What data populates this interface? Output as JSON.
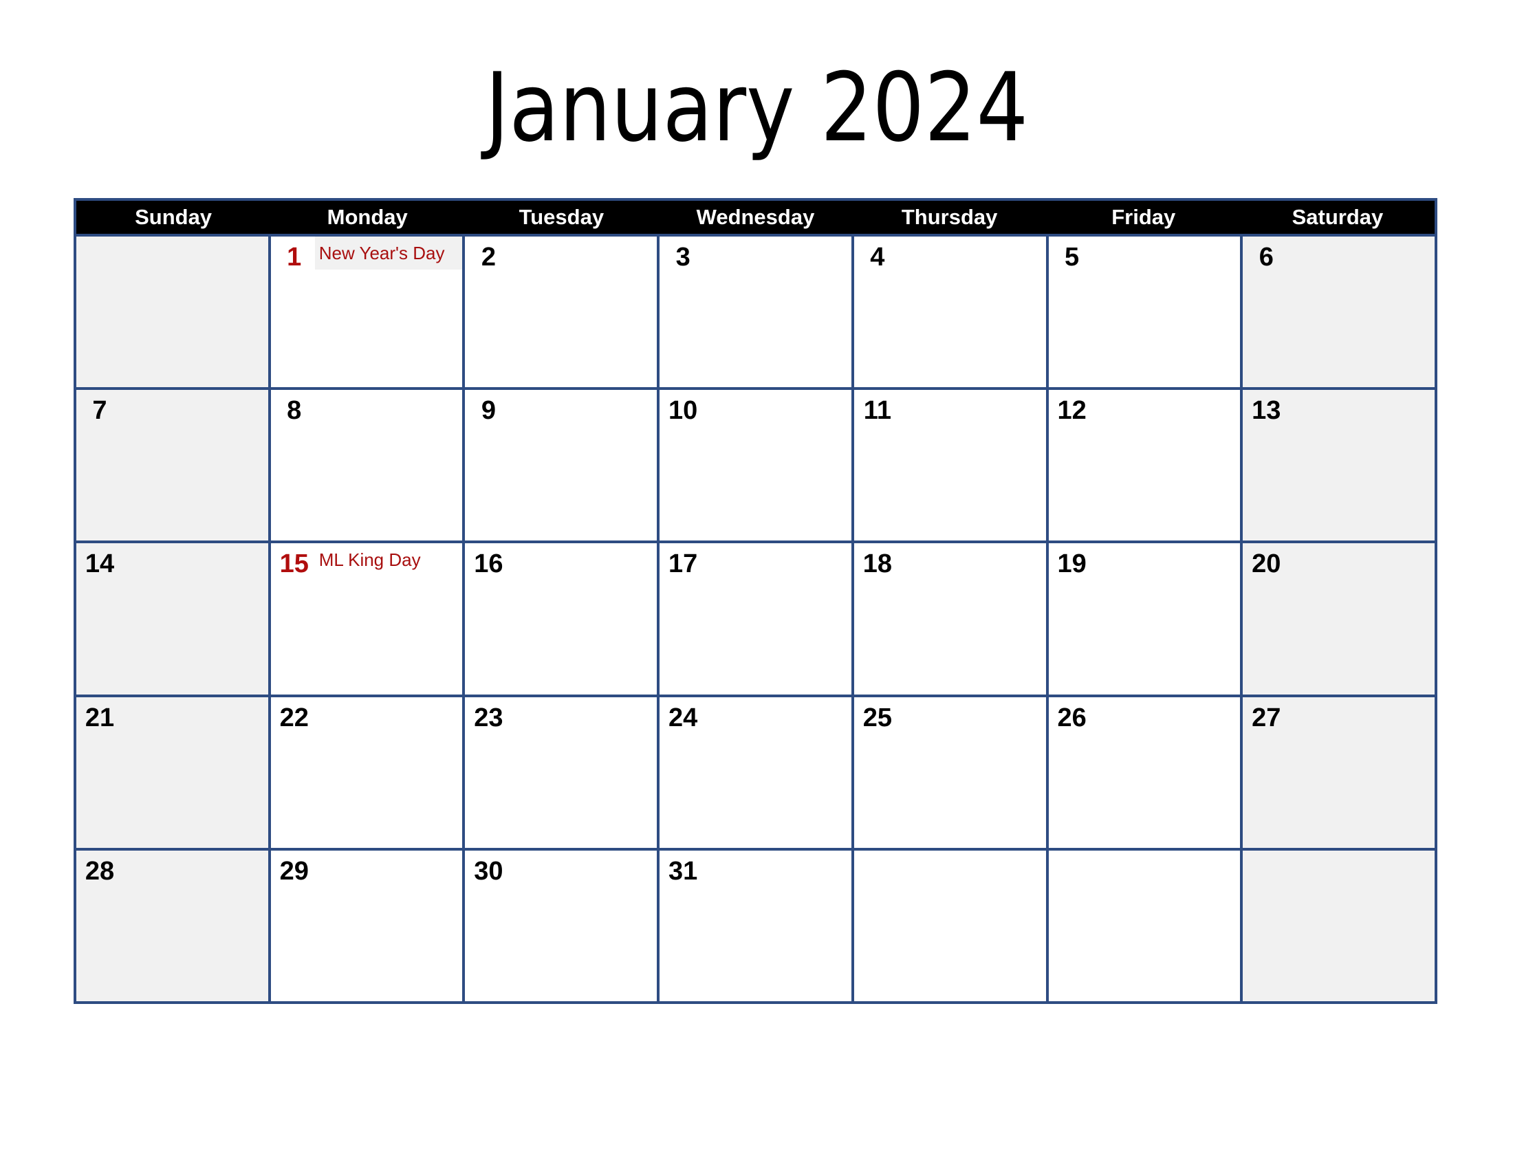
{
  "title": "January 2024",
  "weekdays": [
    "Sunday",
    "Monday",
    "Tuesday",
    "Wednesday",
    "Thursday",
    "Friday",
    "Saturday"
  ],
  "weeks": [
    [
      {
        "day": "",
        "weekend": true
      },
      {
        "day": "1",
        "holiday": "New Year's Day",
        "shaded_label": true
      },
      {
        "day": "2"
      },
      {
        "day": "3"
      },
      {
        "day": "4"
      },
      {
        "day": "5"
      },
      {
        "day": "6",
        "weekend": true
      }
    ],
    [
      {
        "day": "7",
        "weekend": true
      },
      {
        "day": "8"
      },
      {
        "day": "9"
      },
      {
        "day": "10"
      },
      {
        "day": "11"
      },
      {
        "day": "12"
      },
      {
        "day": "13",
        "weekend": true
      }
    ],
    [
      {
        "day": "14",
        "weekend": true
      },
      {
        "day": "15",
        "holiday": "ML King Day"
      },
      {
        "day": "16"
      },
      {
        "day": "17"
      },
      {
        "day": "18"
      },
      {
        "day": "19"
      },
      {
        "day": "20",
        "weekend": true
      }
    ],
    [
      {
        "day": "21",
        "weekend": true
      },
      {
        "day": "22"
      },
      {
        "day": "23"
      },
      {
        "day": "24"
      },
      {
        "day": "25"
      },
      {
        "day": "26"
      },
      {
        "day": "27",
        "weekend": true
      }
    ],
    [
      {
        "day": "28",
        "weekend": true
      },
      {
        "day": "29"
      },
      {
        "day": "30"
      },
      {
        "day": "31"
      },
      {
        "day": ""
      },
      {
        "day": ""
      },
      {
        "day": "",
        "weekend": true
      }
    ]
  ],
  "colors": {
    "grid_border": "#2e4c82",
    "header_bg": "#000000",
    "header_text": "#ffffff",
    "weekend_bg": "#f1f1f1",
    "holiday_text": "#b00d0d"
  }
}
